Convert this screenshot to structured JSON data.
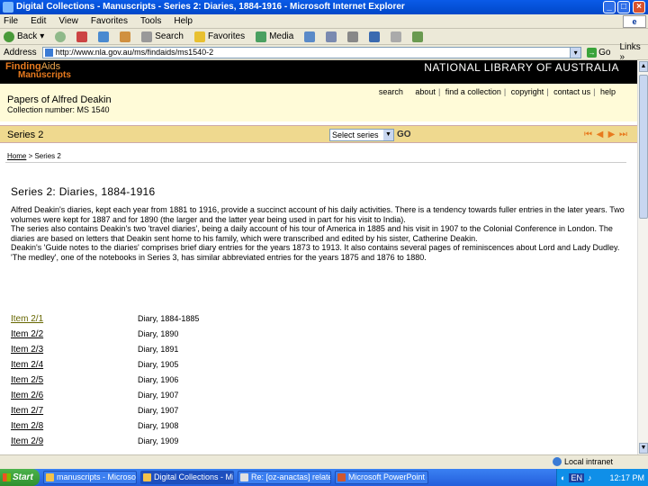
{
  "window": {
    "title": "Digital Collections - Manuscripts - Series 2: Diaries, 1884-1916 - Microsoft Internet Explorer"
  },
  "menu": [
    "File",
    "Edit",
    "View",
    "Favorites",
    "Tools",
    "Help"
  ],
  "toolbar": {
    "back": "Back",
    "search": "Search",
    "favorites": "Favorites",
    "media": "Media"
  },
  "address": {
    "label": "Address",
    "url": "http://www.nla.gov.au/ms/findaids/ms1540-2",
    "go": "Go",
    "links": "Links »"
  },
  "site": {
    "logo_line1": "Finding",
    "logo_line1b": "Aids",
    "logo_line2": "Manuscripts",
    "library_name": "NATIONAL LIBRARY OF AUSTRALIA",
    "nav": [
      "search",
      "about",
      "find a collection",
      "copyright",
      "contact us",
      "help"
    ]
  },
  "collection": {
    "title": "Papers of Alfred Deakin",
    "number": "Collection number: MS 1540"
  },
  "series_bar": {
    "label": "Series 2",
    "select_value": "Select series",
    "go": "GO"
  },
  "breadcrumb": {
    "home": "Home",
    "current": " > Series 2"
  },
  "content": {
    "heading": "Series 2: Diaries, 1884-1916",
    "paragraphs": [
      "Alfred Deakin's diaries, kept each year from 1881 to 1916, provide a succinct account of his daily activities. There is a tendency towards fuller entries in the later years. Two volumes were kept for 1887 and for 1890 (the larger and the latter year being used in part for his visit to India).",
      "The series also contains Deakin's two 'travel diaries', being a daily account of his tour of America in 1885 and his visit in 1907 to the Colonial Conference in London. The diaries are based on letters that Deakin sent home to his family, which were transcribed and edited by his sister, Catherine Deakin.",
      "Deakin's 'Guide notes to the diaries' comprises brief diary entries for the years 1873 to 1913. It also contains several pages of reminiscences about Lord and Lady Dudley. 'The medley', one of the notebooks in Series 3, has similar abbreviated entries for the years 1875 and 1876 to 1880."
    ],
    "items": [
      {
        "id": "Item 2/1",
        "desc": "Diary, 1884-1885",
        "visited": true
      },
      {
        "id": "Item 2/2",
        "desc": "Diary, 1890",
        "visited": false
      },
      {
        "id": "Item 2/3",
        "desc": "Diary, 1891",
        "visited": false
      },
      {
        "id": "Item 2/4",
        "desc": "Diary, 1905",
        "visited": false
      },
      {
        "id": "Item 2/5",
        "desc": "Diary, 1906",
        "visited": false
      },
      {
        "id": "Item 2/6",
        "desc": "Diary, 1907",
        "visited": false
      },
      {
        "id": "Item 2/7",
        "desc": "Diary, 1907",
        "visited": false
      },
      {
        "id": "Item 2/8",
        "desc": "Diary, 1908",
        "visited": false
      },
      {
        "id": "Item 2/9",
        "desc": "Diary, 1909",
        "visited": false
      }
    ]
  },
  "status": {
    "zone": "Local intranet"
  },
  "taskbar": {
    "start": "Start",
    "tasks": [
      {
        "label": "manuscripts - Microsoft ...",
        "active": false
      },
      {
        "label": "Digital Collections - Mi...",
        "active": true
      },
      {
        "label": "Re: [oz-anactas] relate ...",
        "active": false
      },
      {
        "label": "Microsoft PowerPoint - [...",
        "active": false
      }
    ],
    "lang": "EN",
    "clock": "12:17 PM"
  }
}
